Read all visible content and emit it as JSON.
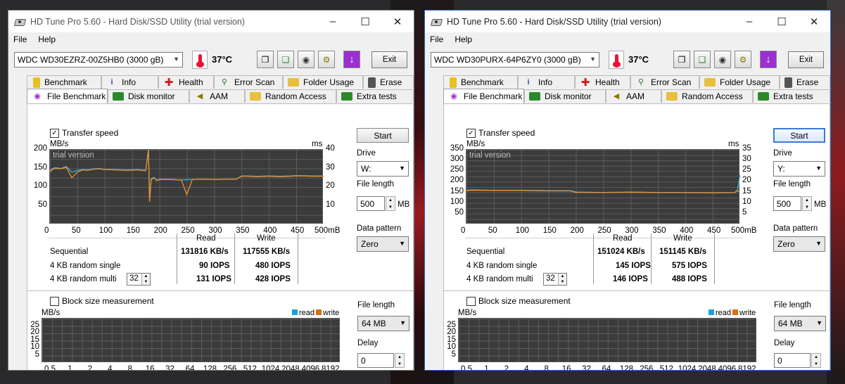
{
  "windows": [
    {
      "title": "HD Tune Pro 5.60 - Hard Disk/SSD Utility (trial version)",
      "menu": [
        "File",
        "Help"
      ],
      "drive": "WDC WD30EZRZ-00Z5HB0 (3000 gB)",
      "temperature": "37°C",
      "exit_label": "Exit",
      "tabs_row1": [
        "Benchmark",
        "Info",
        "Health",
        "Error Scan",
        "Folder Usage",
        "Erase"
      ],
      "tabs_row2": [
        "File Benchmark",
        "Disk monitor",
        "AAM",
        "Random Access",
        "Extra tests"
      ],
      "transfer_speed_label": "Transfer speed",
      "watermark": "trial version",
      "y_unit_left": "MB/s",
      "y_unit_right": "ms",
      "y_ticks_left": [
        "200",
        "150",
        "100",
        "50"
      ],
      "y_ticks_right": [
        "40",
        "30",
        "20",
        "10"
      ],
      "x_ticks": [
        "0",
        "50",
        "100",
        "150",
        "200",
        "250",
        "300",
        "350",
        "400",
        "450",
        "500mB"
      ],
      "col_read": "Read",
      "col_write": "Write",
      "rows": [
        {
          "label": "Sequential",
          "read": "131816 KB/s",
          "write": "117555 KB/s"
        },
        {
          "label": "4 KB random single",
          "read": "90 IOPS",
          "write": "480 IOPS"
        },
        {
          "label": "4 KB random multi",
          "read": "131 IOPS",
          "write": "428 IOPS"
        }
      ],
      "queue_depth": "32",
      "start_label": "Start",
      "drive_label": "Drive",
      "drive_letter": "W:",
      "file_length_label": "File length",
      "file_length_value": "500",
      "file_length_unit": "MB",
      "data_pattern_label": "Data pattern",
      "data_pattern_value": "Zero",
      "block_size_label": "Block size measurement",
      "block_y_unit": "MB/s",
      "block_y_ticks": [
        "25",
        "20",
        "15",
        "10",
        "5"
      ],
      "block_x_ticks": [
        "0.5",
        "1",
        "2",
        "4",
        "8",
        "16",
        "32",
        "64",
        "128",
        "256",
        "512",
        "1024",
        "2048",
        "4096",
        "8192"
      ],
      "legend_read": "read",
      "legend_write": "write",
      "block_file_length_label": "File length",
      "block_file_length_value": "64 MB",
      "delay_label": "Delay",
      "delay_value": "0"
    },
    {
      "title": "HD Tune Pro 5.60 - Hard Disk/SSD Utility (trial version)",
      "menu": [
        "File",
        "Help"
      ],
      "drive": "WDC WD30PURX-64P6ZY0 (3000 gB)",
      "temperature": "37°C",
      "exit_label": "Exit",
      "tabs_row1": [
        "Benchmark",
        "Info",
        "Health",
        "Error Scan",
        "Folder Usage",
        "Erase"
      ],
      "tabs_row2": [
        "File Benchmark",
        "Disk monitor",
        "AAM",
        "Random Access",
        "Extra tests"
      ],
      "transfer_speed_label": "Transfer speed",
      "watermark": "trial version",
      "y_unit_left": "MB/s",
      "y_unit_right": "ms",
      "y_ticks_left": [
        "350",
        "300",
        "250",
        "200",
        "150",
        "100",
        "50"
      ],
      "y_ticks_right": [
        "35",
        "30",
        "25",
        "20",
        "15",
        "10",
        "5"
      ],
      "x_ticks": [
        "0",
        "50",
        "100",
        "150",
        "200",
        "250",
        "300",
        "350",
        "400",
        "450",
        "500mB"
      ],
      "col_read": "Read",
      "col_write": "Write",
      "rows": [
        {
          "label": "Sequential",
          "read": "151024 KB/s",
          "write": "151145 KB/s"
        },
        {
          "label": "4 KB random single",
          "read": "145 IOPS",
          "write": "575 IOPS"
        },
        {
          "label": "4 KB random multi",
          "read": "146 IOPS",
          "write": "488 IOPS"
        }
      ],
      "queue_depth": "32",
      "start_label": "Start",
      "drive_label": "Drive",
      "drive_letter": "Y:",
      "file_length_label": "File length",
      "file_length_value": "500",
      "file_length_unit": "MB",
      "data_pattern_label": "Data pattern",
      "data_pattern_value": "Zero",
      "block_size_label": "Block size measurement",
      "block_y_unit": "MB/s",
      "block_y_ticks": [
        "25",
        "20",
        "15",
        "10",
        "5"
      ],
      "block_x_ticks": [
        "0.5",
        "1",
        "2",
        "4",
        "8",
        "16",
        "32",
        "64",
        "128",
        "256",
        "512",
        "1024",
        "2048",
        "4096",
        "8192"
      ],
      "legend_read": "read",
      "legend_write": "write",
      "block_file_length_label": "File length",
      "block_file_length_value": "64 MB",
      "delay_label": "Delay",
      "delay_value": "0"
    }
  ],
  "chart_data": [
    {
      "type": "line",
      "xlabel": "",
      "ylabel": "MB/s",
      "xlim": [
        0,
        500
      ],
      "ylim": [
        0,
        200
      ],
      "grid": true,
      "series": [
        {
          "name": "",
          "color": "#3ab0e0",
          "x": [
            0,
            5,
            10,
            20,
            30,
            40,
            50,
            60,
            70,
            80,
            90,
            100,
            120,
            140,
            160,
            175,
            180,
            182,
            185,
            190,
            195,
            200,
            220,
            240,
            260,
            280,
            300,
            320,
            340,
            350,
            360,
            380,
            400,
            420,
            440,
            450,
            480,
            500
          ],
          "y": [
            145,
            150,
            152,
            150,
            155,
            140,
            145,
            147,
            146,
            149,
            150,
            148,
            147,
            146,
            147,
            145,
            200,
            70,
            122,
            126,
            118,
            121,
            121,
            119,
            120,
            121,
            120,
            121,
            121,
            130,
            130,
            129,
            130,
            129,
            130,
            131,
            130,
            130
          ]
        },
        {
          "name": "",
          "color": "#e89030",
          "x": [
            0,
            5,
            10,
            20,
            30,
            40,
            50,
            60,
            70,
            80,
            90,
            100,
            120,
            140,
            160,
            175,
            180,
            182,
            185,
            190,
            195,
            200,
            220,
            240,
            250,
            260,
            280,
            300,
            320,
            340,
            350,
            360,
            380,
            400,
            420,
            440,
            450,
            480,
            500
          ],
          "y": [
            140,
            148,
            150,
            149,
            153,
            125,
            140,
            146,
            145,
            148,
            149,
            147,
            146,
            145,
            146,
            144,
            200,
            60,
            120,
            125,
            117,
            120,
            120,
            119,
            80,
            120,
            121,
            120,
            121,
            121,
            129,
            129,
            128,
            129,
            128,
            129,
            130,
            129,
            129
          ]
        }
      ]
    },
    {
      "type": "line",
      "xlabel": "",
      "ylabel": "MB/s",
      "xlim": [
        0,
        500
      ],
      "ylim": [
        0,
        350
      ],
      "grid": true,
      "series": [
        {
          "name": "",
          "color": "#3ab0e0",
          "x": [
            0,
            10,
            50,
            100,
            150,
            190,
            200,
            250,
            300,
            350,
            400,
            450,
            490,
            495,
            500
          ],
          "y": [
            160,
            162,
            160,
            160,
            158,
            158,
            152,
            150,
            152,
            150,
            150,
            149,
            150,
            160,
            235
          ]
        },
        {
          "name": "",
          "color": "#e89030",
          "x": [
            0,
            10,
            50,
            100,
            150,
            190,
            200,
            250,
            300,
            350,
            400,
            450,
            490,
            495,
            500
          ],
          "y": [
            158,
            160,
            159,
            159,
            157,
            157,
            150,
            149,
            151,
            149,
            149,
            148,
            149,
            158,
            150
          ]
        }
      ]
    }
  ]
}
